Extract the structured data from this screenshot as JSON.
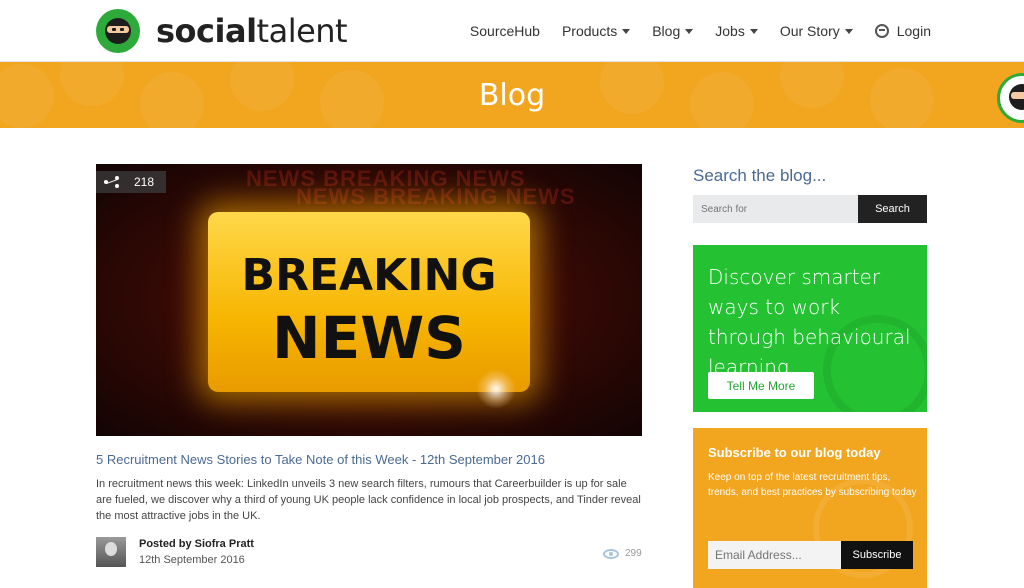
{
  "brand": {
    "logo_bold": "social",
    "logo_rest": "talent"
  },
  "nav": {
    "items": [
      {
        "label": "SourceHub",
        "dropdown": false
      },
      {
        "label": "Products",
        "dropdown": true
      },
      {
        "label": "Blog",
        "dropdown": true
      },
      {
        "label": "Jobs",
        "dropdown": true
      },
      {
        "label": "Our Story",
        "dropdown": true
      }
    ],
    "login": "Login"
  },
  "banner": {
    "title": "Blog"
  },
  "post": {
    "shares": "218",
    "hero_line1": "BREAKING",
    "hero_line2": "NEWS",
    "hero_background_text": "NEWS BREAKING NEWS",
    "title": "5 Recruitment News Stories to Take Note of this Week - 12th September 2016",
    "excerpt": "In recruitment news this week: LinkedIn unveils 3 new search filters, rumours that Careerbuilder is up for sale are fueled, we discover why a third of young UK people lack confidence in local job prospects, and Tinder reveal the most attractive jobs in the UK.",
    "author": "Posted by Siofra Pratt",
    "date": "12th September 2016",
    "views": "299"
  },
  "sidebar": {
    "search_heading": "Search the blog...",
    "search_placeholder": "Search for",
    "search_button": "Search",
    "promo_text": "Discover smarter ways to work through behavioural learning",
    "promo_button": "Tell Me More",
    "subscribe_title": "Subscribe to our blog today",
    "subscribe_text": "Keep on top of the latest recruitment tips, trends, and best practices by subscribing today",
    "email_placeholder": "Email Address...",
    "subscribe_button": "Subscribe"
  },
  "colors": {
    "accent_orange": "#f2a51f",
    "promo_green": "#24c232",
    "link_blue": "#4a6a93"
  },
  "icons": [
    "ninja-logo-icon",
    "chevron-down-icon",
    "login-icon",
    "share-icon",
    "eye-icon"
  ]
}
